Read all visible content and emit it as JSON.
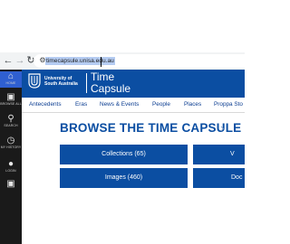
{
  "browser": {
    "back_icon": "back-arrow-icon",
    "forward_icon": "forward-arrow-icon",
    "reload_icon": "reload-icon",
    "site_info_icon": "site-settings-icon",
    "url": "timecapsule.unisa.edu.au"
  },
  "sidebar": {
    "items": [
      {
        "label": "HOME",
        "icon": "home-icon",
        "active": true
      },
      {
        "label": "BROWSE ALL",
        "icon": "image-icon",
        "active": false
      },
      {
        "label": "SEARCH",
        "icon": "search-icon",
        "active": false
      },
      {
        "label": "MY HISTORY",
        "icon": "clock-icon",
        "active": false
      },
      {
        "label": "LOGIN",
        "icon": "user-icon",
        "active": false
      },
      {
        "label": "",
        "icon": "image-icon",
        "active": false
      }
    ]
  },
  "header": {
    "uni_line1": "University of",
    "uni_line2": "South Australia",
    "title_line1": "Time",
    "title_line2": "Capsule",
    "bg_color": "#0b4ea2"
  },
  "menu": {
    "items": [
      "Antecedents",
      "Eras",
      "News & Events",
      "People",
      "Places",
      "Proppa Sto"
    ]
  },
  "main": {
    "heading": "BROWSE THE TIME CAPSULE",
    "heading_chevron": "›",
    "tiles": [
      {
        "label": "Collections (65)"
      },
      {
        "label": "V"
      },
      {
        "label": "Images (460)"
      },
      {
        "label": "Doc"
      }
    ]
  }
}
